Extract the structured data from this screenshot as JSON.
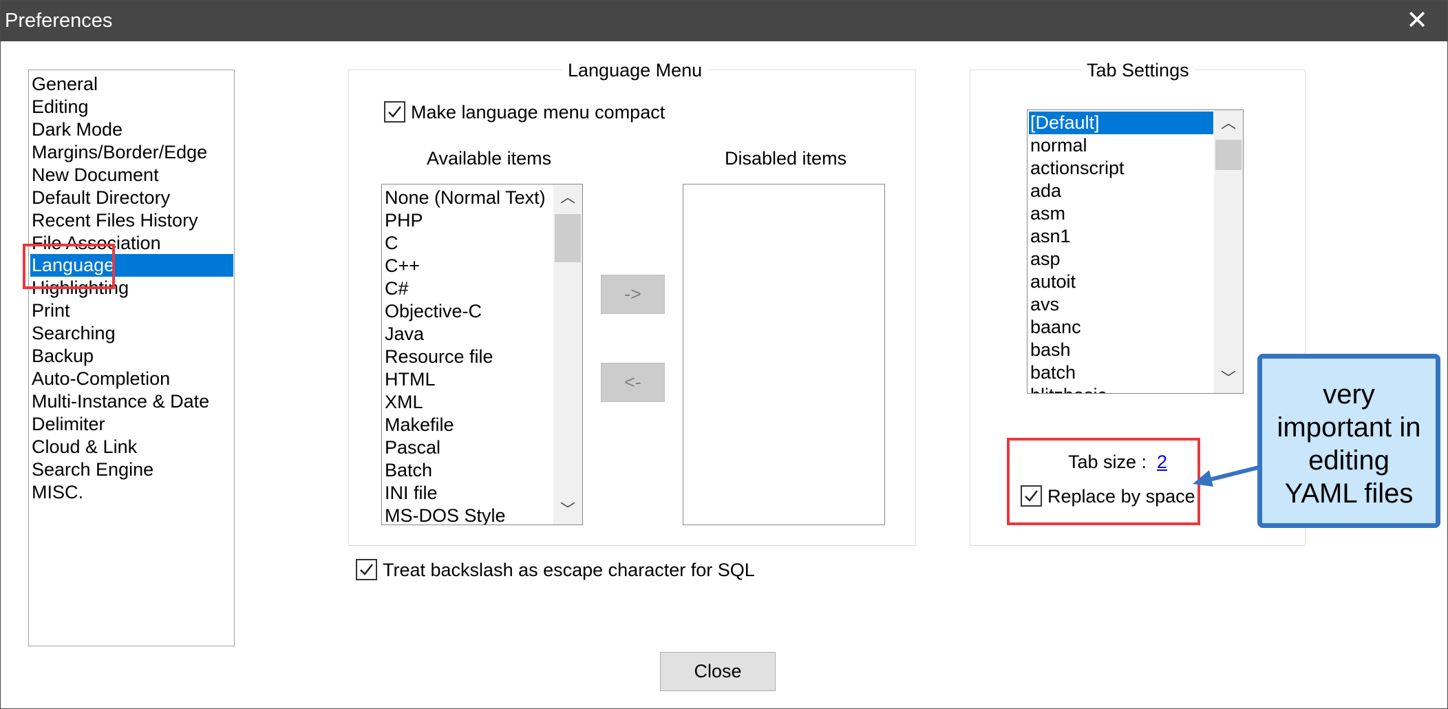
{
  "window": {
    "title": "Preferences",
    "close_icon": "close-icon"
  },
  "sidebar": {
    "items": [
      {
        "label": "General",
        "selected": false
      },
      {
        "label": "Editing",
        "selected": false
      },
      {
        "label": "Dark Mode",
        "selected": false
      },
      {
        "label": "Margins/Border/Edge",
        "selected": false
      },
      {
        "label": "New Document",
        "selected": false
      },
      {
        "label": "Default Directory",
        "selected": false
      },
      {
        "label": "Recent Files History",
        "selected": false
      },
      {
        "label": "File Association",
        "selected": false
      },
      {
        "label": "Language",
        "selected": true
      },
      {
        "label": "Highlighting",
        "selected": false
      },
      {
        "label": "Print",
        "selected": false
      },
      {
        "label": "Searching",
        "selected": false
      },
      {
        "label": "Backup",
        "selected": false
      },
      {
        "label": "Auto-Completion",
        "selected": false
      },
      {
        "label": "Multi-Instance & Date",
        "selected": false
      },
      {
        "label": "Delimiter",
        "selected": false
      },
      {
        "label": "Cloud & Link",
        "selected": false
      },
      {
        "label": "Search Engine",
        "selected": false
      },
      {
        "label": "MISC.",
        "selected": false
      }
    ]
  },
  "language_menu": {
    "title": "Language Menu",
    "compact_label": "Make language menu compact",
    "compact_checked": true,
    "available_header": "Available items",
    "disabled_header": "Disabled items",
    "available_items": [
      "None (Normal Text)",
      "PHP",
      "C",
      "C++",
      "C#",
      "Objective-C",
      "Java",
      "Resource file",
      "HTML",
      "XML",
      "Makefile",
      "Pascal",
      "Batch",
      "INI file",
      "MS-DOS Style"
    ],
    "disabled_items": [],
    "move_right_label": "->",
    "move_left_label": "<-"
  },
  "tab_settings": {
    "title": "Tab Settings",
    "languages": [
      "[Default]",
      "normal",
      "actionscript",
      "ada",
      "asm",
      "asn1",
      "asp",
      "autoit",
      "avs",
      "baanc",
      "bash",
      "batch",
      "blitzbasic"
    ],
    "selected_language": "[Default]",
    "tab_size_label": "Tab size :",
    "tab_size_value": "2",
    "replace_label": "Replace by space",
    "replace_checked": true
  },
  "sql_backslash_label": "Treat backslash as escape character for SQL",
  "sql_backslash_checked": true,
  "close_button_label": "Close",
  "callout": {
    "lines": [
      "very",
      "important in",
      "editing",
      "YAML files"
    ]
  },
  "colors": {
    "title_bar": "#464646",
    "selection": "#0078d7",
    "highlight_box": "#e8393f",
    "callout_fill": "#c9e6fb",
    "callout_border": "#3574c2"
  }
}
